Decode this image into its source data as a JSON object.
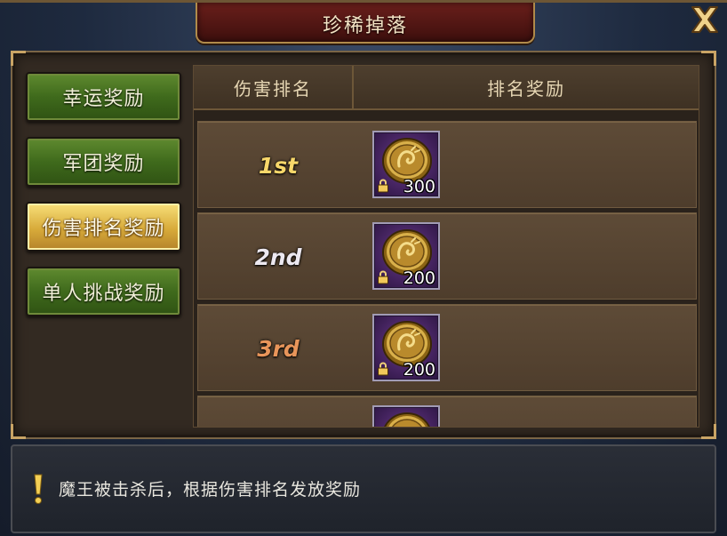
{
  "window": {
    "title": "珍稀掉落"
  },
  "sidebar": {
    "items": [
      {
        "label": "幸运奖励",
        "active": false
      },
      {
        "label": "军团奖励",
        "active": false
      },
      {
        "label": "伤害排名奖励",
        "active": true
      },
      {
        "label": "单人挑战奖励",
        "active": false
      }
    ]
  },
  "table": {
    "headers": {
      "rank": "伤害排名",
      "reward": "排名奖励"
    },
    "rows": [
      {
        "rank": "1st",
        "reward_icon": "gold-coin-icon",
        "quantity": "300",
        "locked": true
      },
      {
        "rank": "2nd",
        "reward_icon": "gold-coin-icon",
        "quantity": "200",
        "locked": true
      },
      {
        "rank": "3rd",
        "reward_icon": "gold-coin-icon",
        "quantity": "200",
        "locked": true
      }
    ]
  },
  "info": {
    "icon": "exclamation-icon",
    "text": "魔王被击杀后，根据伤害排名发放奖励"
  },
  "colors": {
    "rank_1st": "#f7d76a",
    "rank_2nd": "#ece8f0",
    "rank_3rd": "#e8955a",
    "active_tab": "#d8ab3a",
    "inactive_tab": "#3f6a1c"
  }
}
